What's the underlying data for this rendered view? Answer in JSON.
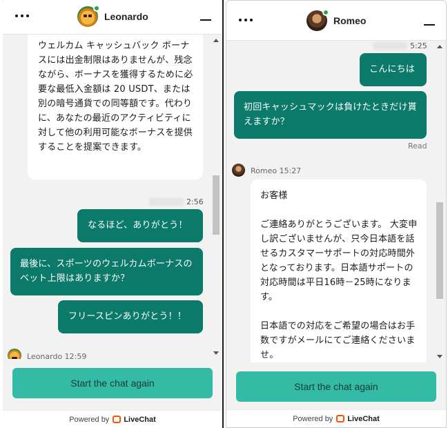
{
  "left": {
    "agent_name": "Leonardo",
    "messages": [
      {
        "type": "agent",
        "text": "ウェルカム キャッシュバック ボーナスには出金制限はありませんが、残念ながら、ボーナスを獲得するために必要な最低入金額は 20 USDT、または別の暗号通貨での同等額です。代わりに、あなたの最近のアクティビティに対して他の利用可能なボーナスを提供することを提案できます。"
      },
      {
        "type": "time",
        "text": "2:56"
      },
      {
        "type": "user",
        "text": "なるほど、ありがとう！"
      },
      {
        "type": "user",
        "text": "最後に、スポーツのウェルカムボーナスのベット上限はありますか？"
      },
      {
        "type": "user",
        "text": "フリースピンありがとう！！"
      },
      {
        "type": "agent_meta",
        "text": "Leonardo 12:59"
      }
    ],
    "cta_label": "Start the chat again",
    "powered_by": "Powered by",
    "brand": "LiveChat"
  },
  "right": {
    "agent_name": "Romeo",
    "messages": [
      {
        "type": "time",
        "text": "5:25"
      },
      {
        "type": "user",
        "text": "こんにちは"
      },
      {
        "type": "user",
        "text": "初回キャッシュマックは負けたときだけ貰えますか？"
      },
      {
        "type": "status",
        "text": "Read"
      },
      {
        "type": "agent_meta",
        "text": "Romeo 15:27"
      },
      {
        "type": "agent",
        "text": "お客様\n\nご連絡ありがとうございます。 大変申し訳ございませんが、只今日本語を話せるカスタマーサポートの対応時間外となっております。日本語サポートの対応時間は平日16時－25時になります。\n\n日本語での対応をご希望の場合はお手数ですがメールにてご連絡くださいませ。"
      }
    ],
    "cta_label": "Start the chat again",
    "powered_by": "Powered by",
    "brand": "LiveChat"
  },
  "colors": {
    "user_bubble": "#0b7a6a",
    "cta": "#33bba5",
    "online": "#2ea44f",
    "brand": "#ff5100"
  }
}
